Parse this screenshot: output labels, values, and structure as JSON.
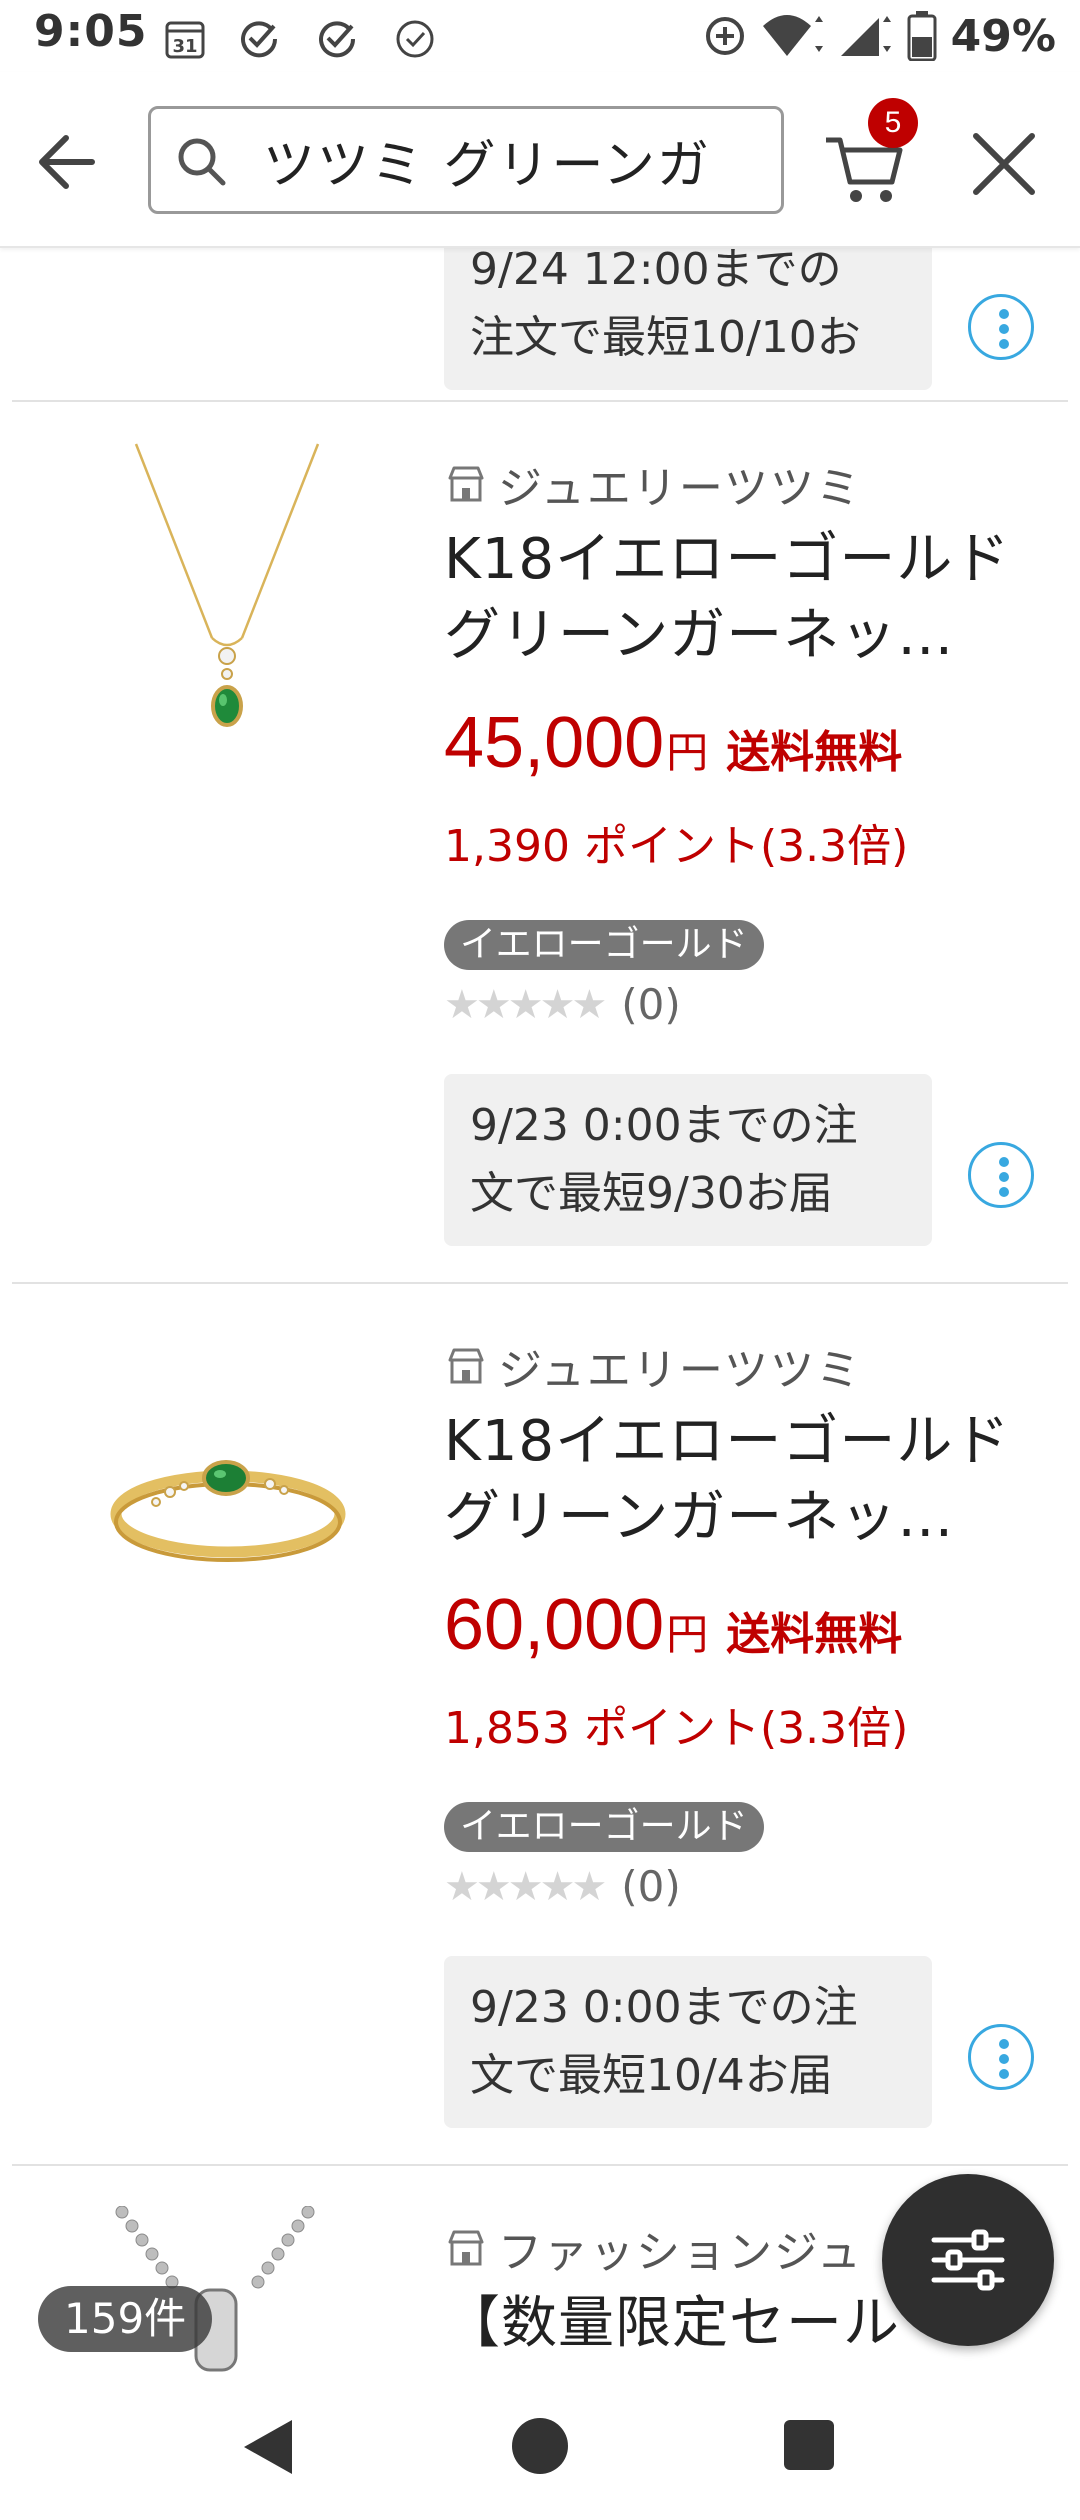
{
  "status_bar": {
    "time": "9:05",
    "calendar_date": "31",
    "battery_percent": "49%"
  },
  "header": {
    "search_query": "ツツミ グリーンガ",
    "cart_count": "5"
  },
  "partial_top_item": {
    "delivery_line1": "9/24 12:00までの",
    "delivery_line2": "注文で最短10/10お"
  },
  "products": [
    {
      "shop": "ジュエリーツツミ",
      "title_line1": "K18イエローゴールド",
      "title_line2": "グリーンガーネッ…",
      "price": "45,000",
      "yen": "円",
      "shipping": "送料無料",
      "points": "1,390 ポイント(3.3倍)",
      "tag": "イエローゴールド",
      "stars": "★★★★★",
      "rating_value": 0,
      "review_count": "(0)",
      "delivery_line1": "9/23 0:00までの注",
      "delivery_line2": "文で最短9/30お届"
    },
    {
      "shop": "ジュエリーツツミ",
      "title_line1": "K18イエローゴールド",
      "title_line2": "グリーンガーネッ…",
      "price": "60,000",
      "yen": "円",
      "shipping": "送料無料",
      "points": "1,853 ポイント(3.3倍)",
      "tag": "イエローゴールド",
      "stars": "★★★★★",
      "rating_value": 0,
      "review_count": "(0)",
      "delivery_line1": "9/23 0:00までの注",
      "delivery_line2": "文で最短10/4お届"
    },
    {
      "shop": "ファッションジュ",
      "title_line1": "【数量限定セール"
    }
  ],
  "result_count": "159件",
  "colors": {
    "price_red": "#bf0000",
    "kebab_blue": "#38a8e0",
    "tag_gray": "#777777"
  }
}
